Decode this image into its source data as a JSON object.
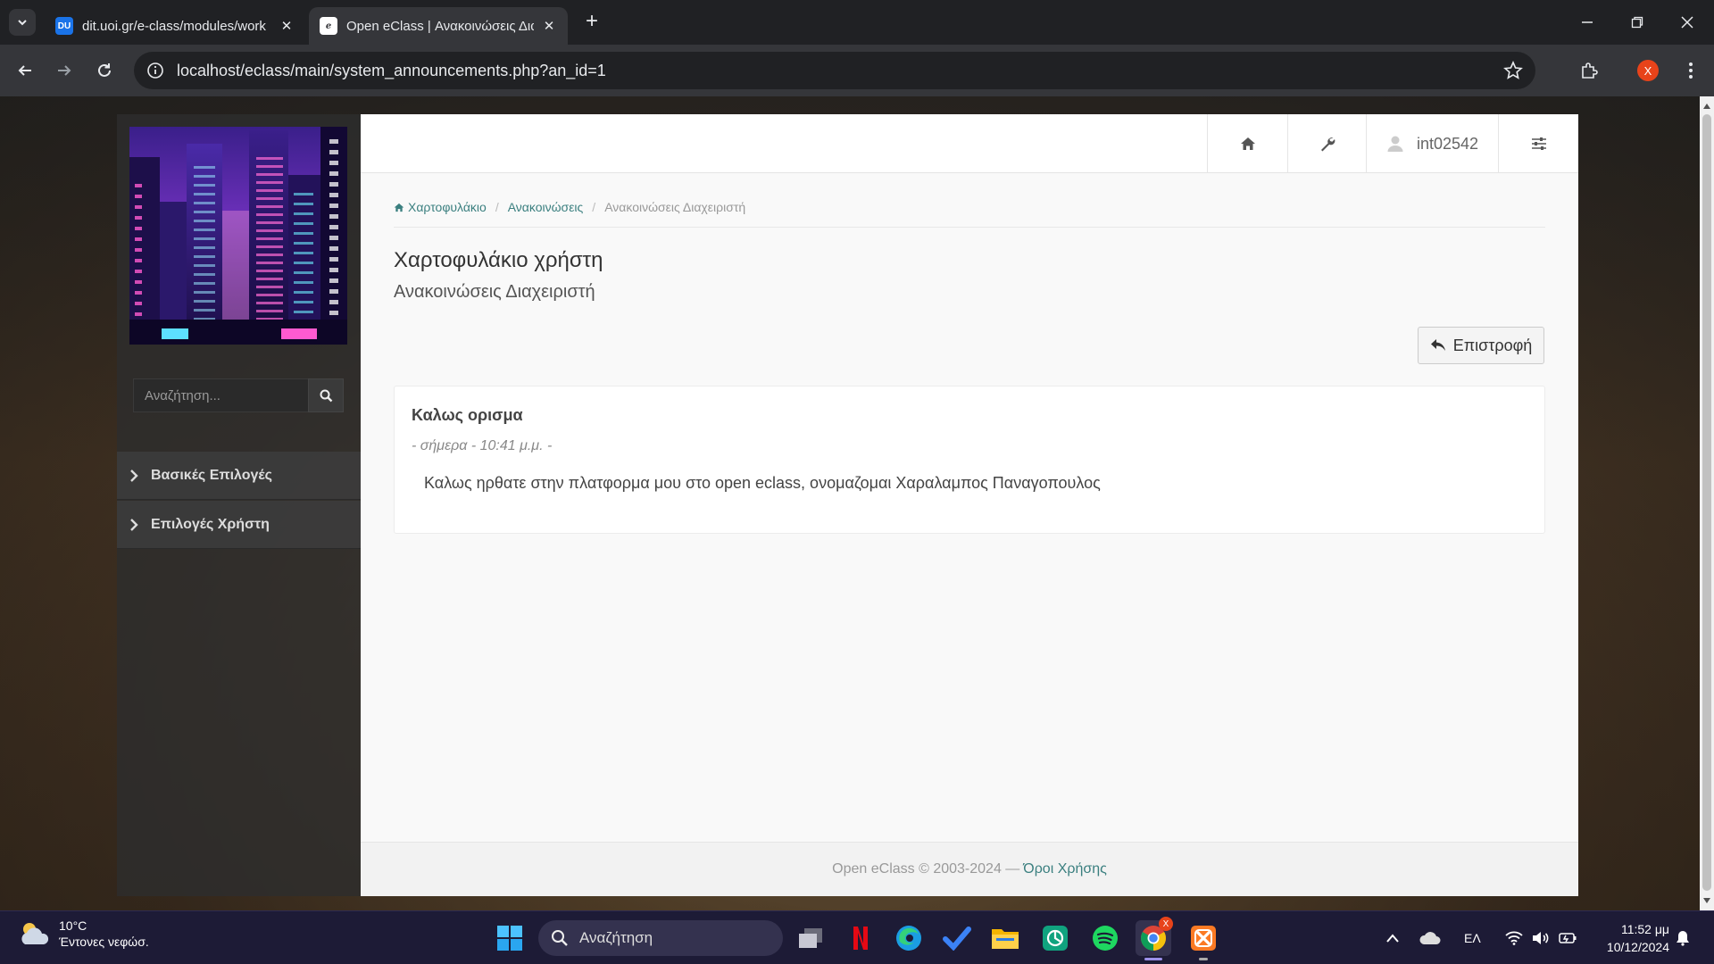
{
  "browser": {
    "tabs": [
      {
        "title": "dit.uoi.gr/e-class/modules/work",
        "favicon": "duth-icon",
        "active": false
      },
      {
        "title": "Open eClass | Ανακοινώσεις Δια",
        "favicon": "eclass-icon",
        "active": true
      }
    ],
    "url": "localhost/eclass/main/system_announcements.php?an_id=1",
    "profile_initial": "X"
  },
  "sidebar": {
    "search_placeholder": "Αναζήτηση...",
    "menu": [
      {
        "label": "Βασικές Επιλογές"
      },
      {
        "label": "Επιλογές Χρήστη"
      }
    ]
  },
  "topnav": {
    "username": "int02542"
  },
  "breadcrumb": {
    "items": [
      "Χαρτοφυλάκιο",
      "Ανακοινώσεις",
      "Ανακοινώσεις Διαχειριστή"
    ]
  },
  "page": {
    "title": "Χαρτοφυλάκιο χρήστη",
    "subtitle": "Ανακοινώσεις Διαχειριστή",
    "back_label": "Επιστροφή"
  },
  "announcement": {
    "title": "Καλως ορισμα",
    "date": "- σήμερα - 10:41 μ.μ. -",
    "content": "Καλως ηρθατε στην πλατφορμα μου στο open eclass, ονομαζομαι Χαραλαμπος Παναγοπουλος"
  },
  "footer": {
    "copyright": "Open eClass © 2003-2024 —",
    "terms_link": "Όροι Χρήσης"
  },
  "taskbar": {
    "weather_temp": "10°C",
    "weather_cond": "Έντονες νεφώσ.",
    "search_label": "Αναζήτηση",
    "language": "ΕΛ",
    "time": "11:52 μμ",
    "date": "10/12/2024",
    "chrome_badge": "X"
  },
  "colors": {
    "link": "#3a7f7f",
    "taskbar": "#1d1b36",
    "chrome_dark": "#202124",
    "chrome_toolbar": "#35363a"
  }
}
